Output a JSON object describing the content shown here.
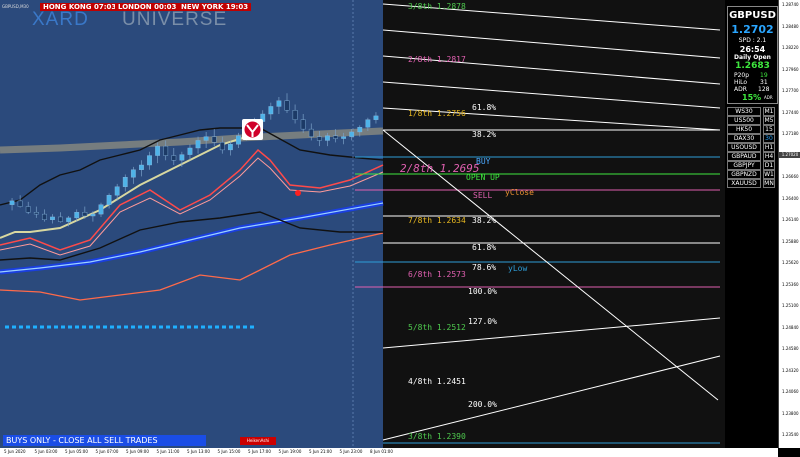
{
  "window_label": "GBPUSD,M30",
  "sessions": [
    {
      "label": "HONG KONG  07:03"
    },
    {
      "label": "LONDON  00:03"
    },
    {
      "label": "NEW YORK  19:03"
    }
  ],
  "brand": {
    "left": "XARD",
    "right": "UNIVERSE"
  },
  "murrey_levels": [
    {
      "label": "3/8th  1.2878",
      "color": "#4ec94e"
    },
    {
      "label": "2/8th  1.2817",
      "color": "#e060b0"
    },
    {
      "label": "1/8th  1.2756",
      "color": "#e8b820"
    },
    {
      "label": "7/8th  1.2634",
      "color": "#e8b820"
    },
    {
      "label": "6/8th  1.2573",
      "color": "#e060b0"
    },
    {
      "label": "5/8th  1.2512",
      "color": "#4ec94e"
    },
    {
      "label": "4/8th  1.2451",
      "color": "#ffffff"
    },
    {
      "label": "3/8th  1.2390",
      "color": "#4ec94e"
    }
  ],
  "fib_levels": [
    "61.8%",
    "38.2%",
    "38.2%",
    "61.8%",
    "78.6%",
    "100.0%",
    "127.0%",
    "200.0%"
  ],
  "signals": {
    "buy": "BUY",
    "open_up": "OPEN UP",
    "sell": "SELL",
    "yclose": "yClose",
    "ylow": "yLow",
    "current_level": "2/8th 1.2695"
  },
  "info_panel": {
    "symbol": "GBPUSD",
    "price": "1.2702",
    "spd": "SPD : 2.1",
    "timer": "26:54",
    "daily_open_label": "Daily Open",
    "daily_open": "1.2683",
    "stats": [
      {
        "k": "P20p",
        "v": "19"
      },
      {
        "k": "HiLo",
        "v": "31"
      },
      {
        "k": "ADR",
        "v": "128"
      }
    ],
    "adr_pct": "15%",
    "adr_sub": "ADR"
  },
  "symbols": [
    {
      "name": "WS30",
      "tf": "M1"
    },
    {
      "name": "US500",
      "tf": "M5"
    },
    {
      "name": "HK50",
      "tf": "15"
    },
    {
      "name": "DAX30",
      "tf": "30"
    },
    {
      "name": "USOUSD",
      "tf": "H1"
    },
    {
      "name": "GBPAUD",
      "tf": "H4"
    },
    {
      "name": "GBPJPY",
      "tf": "D1"
    },
    {
      "name": "GBPNZD",
      "tf": "W1"
    },
    {
      "name": "XAUUSD",
      "tf": "MN"
    }
  ],
  "price_scale": [
    "1.28740",
    "1.28480",
    "1.28220",
    "1.27960",
    "1.27700",
    "1.27440",
    "1.27180",
    "1.26920",
    "1.26660",
    "1.26400",
    "1.26140",
    "1.25880",
    "1.25620",
    "1.25360",
    "1.25100",
    "1.24840",
    "1.24580",
    "1.24320",
    "1.24060",
    "1.23800",
    "1.23540"
  ],
  "current_price_tag": "1.27020",
  "time_axis": [
    "5 Jun 2020",
    "5 Jun 03:00",
    "5 Jun 05:00",
    "5 Jun 07:00",
    "5 Jun 09:00",
    "5 Jun 11:00",
    "5 Jun 13:00",
    "5 Jun 15:00",
    "5 Jun 17:00",
    "5 Jun 19:00",
    "5 Jun 21:00",
    "5 Jun 23:00",
    "8 Jun 01:00"
  ],
  "banner": "BUYS ONLY - CLOSE ALL SELL TRADES",
  "heiken_label": "HeikenAshi",
  "chart_data": {
    "type": "candlestick",
    "candles": [
      [
        1.2608,
        1.2615,
        1.2602,
        1.2612
      ],
      [
        1.2612,
        1.2618,
        1.2605,
        1.2606
      ],
      [
        1.2606,
        1.2611,
        1.2598,
        1.26
      ],
      [
        1.26,
        1.2606,
        1.2594,
        1.2598
      ],
      [
        1.2598,
        1.2603,
        1.259,
        1.2592
      ],
      [
        1.2592,
        1.2598,
        1.2588,
        1.2595
      ],
      [
        1.2595,
        1.26,
        1.2589,
        1.259
      ],
      [
        1.259,
        1.2596,
        1.2585,
        1.2594
      ],
      [
        1.2594,
        1.2603,
        1.259,
        1.26
      ],
      [
        1.26,
        1.2606,
        1.2593,
        1.2596
      ],
      [
        1.2596,
        1.2601,
        1.259,
        1.2598
      ],
      [
        1.2598,
        1.261,
        1.2595,
        1.2608
      ],
      [
        1.2608,
        1.262,
        1.2604,
        1.2618
      ],
      [
        1.2618,
        1.263,
        1.2612,
        1.2627
      ],
      [
        1.2627,
        1.264,
        1.2622,
        1.2637
      ],
      [
        1.2637,
        1.2648,
        1.263,
        1.2645
      ],
      [
        1.2645,
        1.2655,
        1.2638,
        1.265
      ],
      [
        1.265,
        1.2664,
        1.2645,
        1.266
      ],
      [
        1.266,
        1.2674,
        1.2652,
        1.267
      ],
      [
        1.267,
        1.2676,
        1.2655,
        1.266
      ],
      [
        1.266,
        1.2668,
        1.265,
        1.2655
      ],
      [
        1.2655,
        1.2664,
        1.2648,
        1.2661
      ],
      [
        1.2661,
        1.2672,
        1.2655,
        1.2668
      ],
      [
        1.2668,
        1.268,
        1.2662,
        1.2676
      ],
      [
        1.2676,
        1.2685,
        1.2668,
        1.268
      ],
      [
        1.268,
        1.2688,
        1.267,
        1.2674
      ],
      [
        1.2674,
        1.268,
        1.2662,
        1.2666
      ],
      [
        1.2666,
        1.2675,
        1.266,
        1.2672
      ],
      [
        1.2672,
        1.2684,
        1.2668,
        1.2681
      ],
      [
        1.2681,
        1.2692,
        1.2676,
        1.2688
      ],
      [
        1.2688,
        1.27,
        1.2682,
        1.2696
      ],
      [
        1.2696,
        1.2708,
        1.269,
        1.2704
      ],
      [
        1.2704,
        1.2716,
        1.2698,
        1.2712
      ],
      [
        1.2712,
        1.2722,
        1.2704,
        1.2718
      ],
      [
        1.2718,
        1.2726,
        1.2705,
        1.2708
      ],
      [
        1.2708,
        1.2714,
        1.2694,
        1.2698
      ],
      [
        1.2698,
        1.2704,
        1.2684,
        1.2688
      ],
      [
        1.2688,
        1.2694,
        1.2676,
        1.268
      ],
      [
        1.268,
        1.2686,
        1.267,
        1.2676
      ],
      [
        1.2676,
        1.2684,
        1.267,
        1.2681
      ],
      [
        1.2681,
        1.2688,
        1.2674,
        1.2678
      ],
      [
        1.2678,
        1.2684,
        1.2672,
        1.268
      ],
      [
        1.268,
        1.2688,
        1.2676,
        1.2685
      ],
      [
        1.2685,
        1.2692,
        1.268,
        1.269
      ],
      [
        1.269,
        1.27,
        1.2686,
        1.2698
      ],
      [
        1.2698,
        1.2706,
        1.2694,
        1.2702
      ]
    ],
    "ylim": [
      1.235,
      1.288
    ]
  }
}
